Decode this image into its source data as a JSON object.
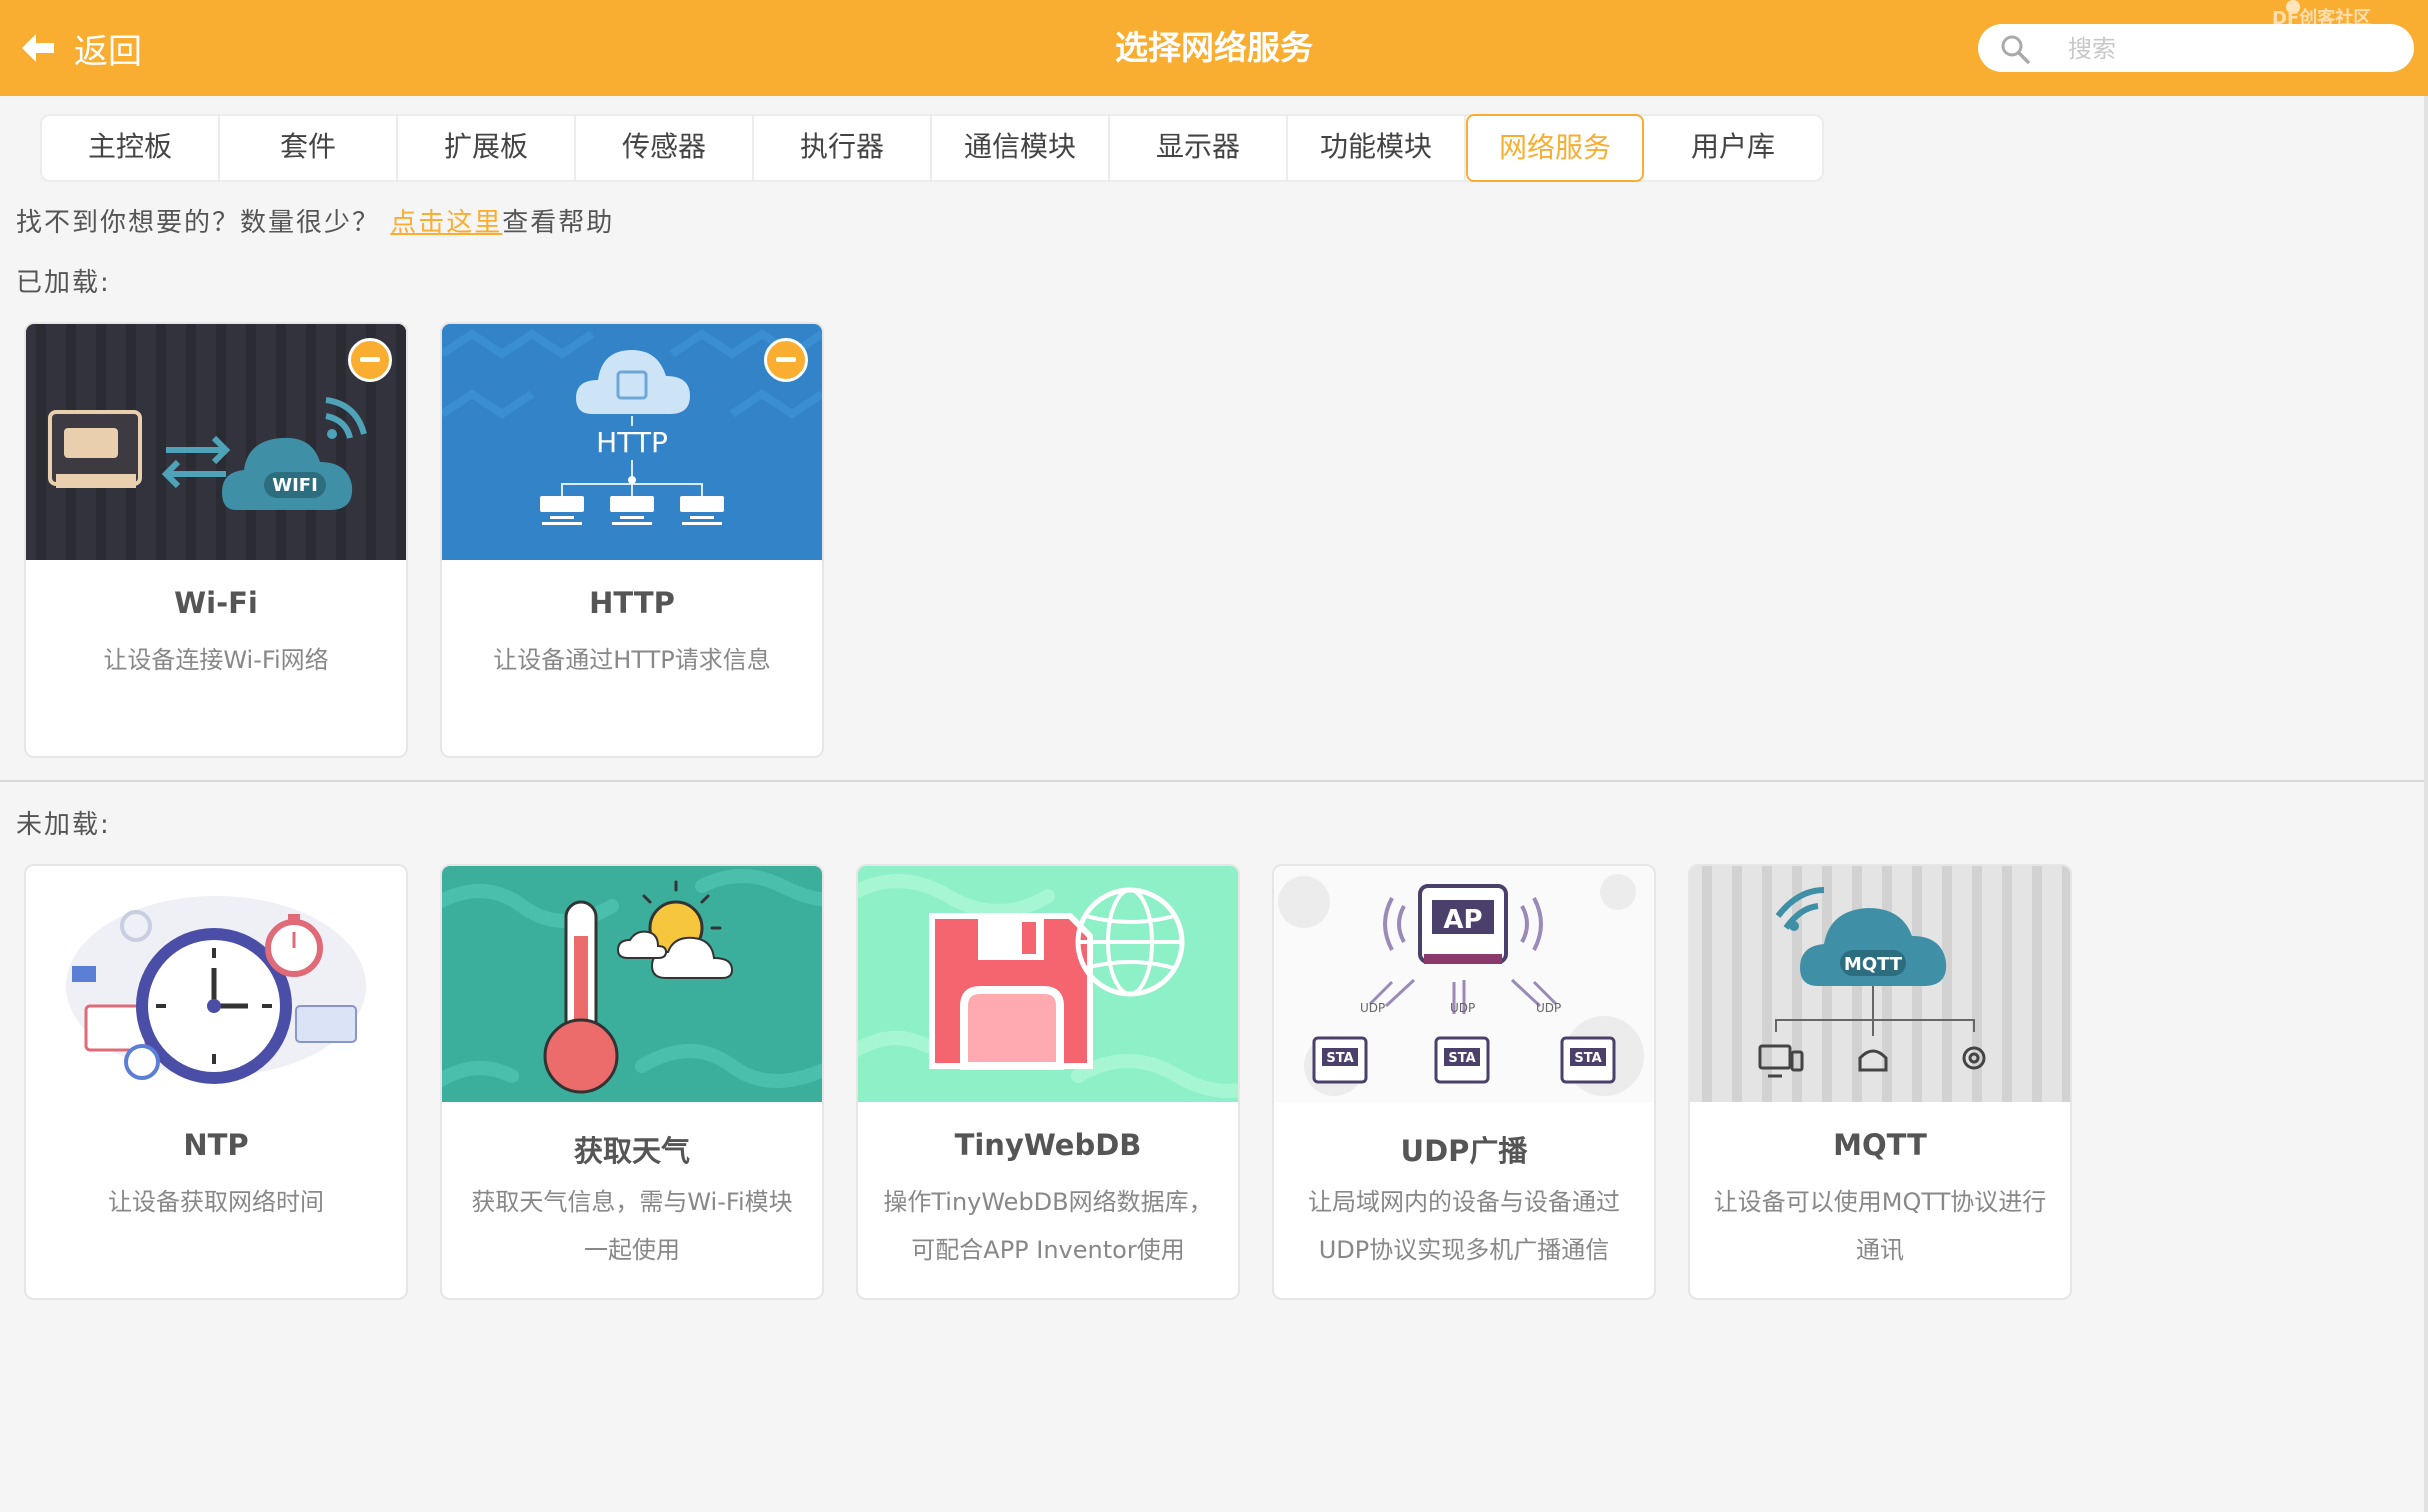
{
  "header": {
    "back_label": "返回",
    "title": "选择网络服务",
    "search_placeholder": "搜索",
    "watermark": "DF创客社区",
    "accent_color": "#f9ae31"
  },
  "tabs": [
    {
      "label": "主控板"
    },
    {
      "label": "套件"
    },
    {
      "label": "扩展板"
    },
    {
      "label": "传感器"
    },
    {
      "label": "执行器"
    },
    {
      "label": "通信模块"
    },
    {
      "label": "显示器"
    },
    {
      "label": "功能模块"
    },
    {
      "label": "网络服务",
      "active": true
    },
    {
      "label": "用户库"
    }
  ],
  "help": {
    "prefix": "找不到你想要的？数量很少？",
    "link": "点击这里",
    "suffix": "查看帮助"
  },
  "loaded": {
    "label": "已加载:",
    "cards": [
      {
        "name": "Wi-Fi",
        "desc": "让设备连接Wi-Fi网络",
        "icon": "wifi-cloud-illustration",
        "image_text": "WIFI"
      },
      {
        "name": "HTTP",
        "desc": "让设备通过HTTP请求信息",
        "icon": "http-cloud-illustration",
        "image_text": "HTTP"
      }
    ]
  },
  "unloaded": {
    "label": "未加载:",
    "cards": [
      {
        "name": "NTP",
        "desc": "让设备获取网络时间",
        "icon": "clock-illustration"
      },
      {
        "name": "获取天气",
        "desc": "获取天气信息，需与Wi-Fi模块一起使用",
        "icon": "thermometer-sun-illustration"
      },
      {
        "name": "TinyWebDB",
        "desc": "操作TinyWebDB网络数据库，可配合APP Inventor使用",
        "icon": "floppy-globe-illustration"
      },
      {
        "name": "UDP广播",
        "desc": "让局域网内的设备与设备通过UDP协议实现多机广播通信",
        "icon": "udp-broadcast-illustration",
        "image_text": {
          "ap": "AP",
          "udp": "UDP",
          "sta": "STA"
        }
      },
      {
        "name": "MQTT",
        "desc": "让设备可以使用MQTT协议进行通讯",
        "icon": "mqtt-cloud-illustration",
        "image_text": "MQTT"
      }
    ]
  }
}
